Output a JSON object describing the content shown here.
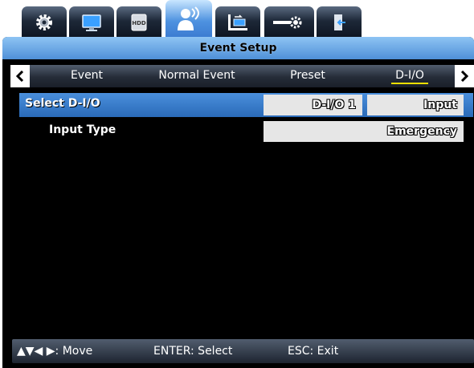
{
  "tabs": [
    {
      "icon": "gear-icon"
    },
    {
      "icon": "monitor-icon"
    },
    {
      "icon": "hdd-icon",
      "label": "HDD"
    },
    {
      "icon": "person-sensor-icon",
      "active": true
    },
    {
      "icon": "network-icon"
    },
    {
      "icon": "system-settings-icon"
    },
    {
      "icon": "exit-door-icon"
    }
  ],
  "header": {
    "title": "Event Setup"
  },
  "subtabs": [
    {
      "label": "Event"
    },
    {
      "label": "Normal Event"
    },
    {
      "label": "Preset"
    },
    {
      "label": "D-I/O",
      "active": true
    }
  ],
  "rows": [
    {
      "label": "Select D-I/O",
      "value1": "D-I/O 1",
      "value2": "Input"
    },
    {
      "label": "Input Type",
      "value": "Emergency"
    }
  ],
  "status": {
    "move": ": Move",
    "select": "ENTER: Select",
    "exit": "ESC: Exit"
  },
  "colors": {
    "accent_blue": "#4f90d8",
    "active_underline": "#f0e000",
    "background": "#000000"
  }
}
